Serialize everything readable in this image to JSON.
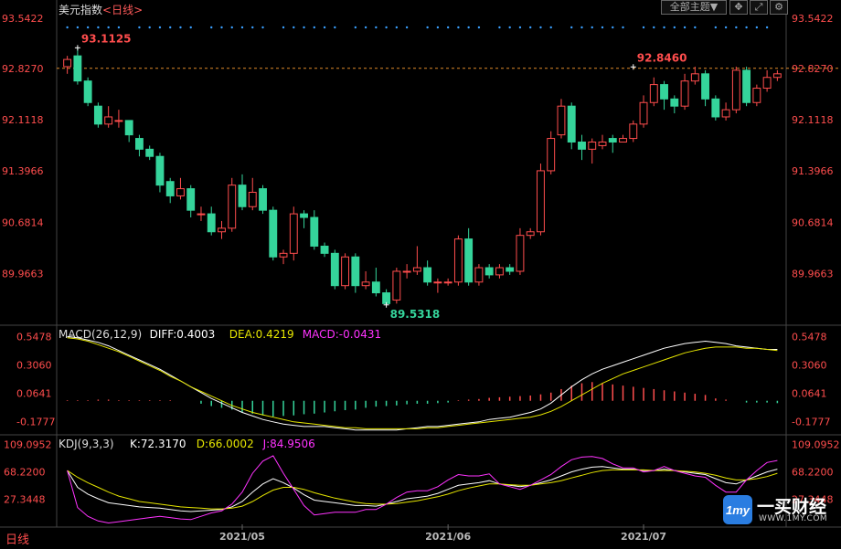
{
  "header": {
    "symbol": "美元指数",
    "period_link": "<日线>",
    "theme_button": "全部主题▼",
    "icons": [
      "move-icon",
      "expand-icon",
      "settings-icon"
    ]
  },
  "footer": {
    "period_label": "日线"
  },
  "watermark": {
    "brand": "一买财经",
    "url": "WWW.1MY.COM"
  },
  "colors": {
    "up": "#ff4d4d",
    "down": "#35d49b",
    "diff": "#ffffff",
    "dea": "#e6e600",
    "macd": "#ff33ff",
    "k": "#ffffff",
    "d": "#e6e600",
    "j": "#ff33ff",
    "axis": "#ff4d4d"
  },
  "chart_data": [
    {
      "type": "candlestick",
      "title": "",
      "y_ticks": [
        "93.5422",
        "92.8270",
        "92.1118",
        "91.3966",
        "90.6814",
        "89.9663"
      ],
      "ylim": [
        89.3,
        93.6
      ],
      "reference_line": 92.827,
      "annotations": [
        {
          "label": "93.1125",
          "index": 1,
          "value": 93.1125
        },
        {
          "label": "92.8460",
          "index": 55,
          "value": 92.846
        },
        {
          "label": "89.5318",
          "index": 31,
          "value": 89.5318
        }
      ],
      "x_ticks": [
        {
          "label": "2021/05",
          "index": 17
        },
        {
          "label": "2021/06",
          "index": 37
        },
        {
          "label": "2021/07",
          "index": 56
        }
      ],
      "candles": [
        [
          92.85,
          92.95,
          93.0,
          92.75
        ],
        [
          93.0,
          92.65,
          93.11,
          92.6
        ],
        [
          92.65,
          92.35,
          92.7,
          92.3
        ],
        [
          92.3,
          92.05,
          92.35,
          92.0
        ],
        [
          92.05,
          92.15,
          92.3,
          92.0
        ],
        [
          92.1,
          92.1,
          92.25,
          92.0
        ],
        [
          92.1,
          91.9,
          92.1,
          91.8
        ],
        [
          91.85,
          91.7,
          91.9,
          91.6
        ],
        [
          91.7,
          91.6,
          91.75,
          91.55
        ],
        [
          91.6,
          91.2,
          91.65,
          91.1
        ],
        [
          91.25,
          91.05,
          91.3,
          90.95
        ],
        [
          91.05,
          91.15,
          91.3,
          91.0
        ],
        [
          91.15,
          90.85,
          91.2,
          90.75
        ],
        [
          90.8,
          90.8,
          90.9,
          90.7
        ],
        [
          90.8,
          90.55,
          90.9,
          90.5
        ],
        [
          90.55,
          90.6,
          90.7,
          90.45
        ],
        [
          90.6,
          91.2,
          91.3,
          90.55
        ],
        [
          91.2,
          90.9,
          91.35,
          90.85
        ],
        [
          90.9,
          91.1,
          91.3,
          90.85
        ],
        [
          91.15,
          90.85,
          91.2,
          90.8
        ],
        [
          90.85,
          90.2,
          90.9,
          90.15
        ],
        [
          90.2,
          90.25,
          90.3,
          90.1
        ],
        [
          90.25,
          90.8,
          90.9,
          90.15
        ],
        [
          90.8,
          90.75,
          90.85,
          90.6
        ],
        [
          90.75,
          90.35,
          90.85,
          90.3
        ],
        [
          90.35,
          90.25,
          90.4,
          90.2
        ],
        [
          90.25,
          89.8,
          90.3,
          89.75
        ],
        [
          89.8,
          90.2,
          90.25,
          89.75
        ],
        [
          90.2,
          89.8,
          90.25,
          89.7
        ],
        [
          89.8,
          89.85,
          90.0,
          89.75
        ],
        [
          89.85,
          89.7,
          90.05,
          89.65
        ],
        [
          89.7,
          89.55,
          89.75,
          89.53
        ],
        [
          89.6,
          90.0,
          90.05,
          89.55
        ],
        [
          90.0,
          90.0,
          90.1,
          89.9
        ],
        [
          90.0,
          90.05,
          90.35,
          89.95
        ],
        [
          90.05,
          89.85,
          90.15,
          89.8
        ],
        [
          89.85,
          89.85,
          89.9,
          89.7
        ],
        [
          89.85,
          89.85,
          89.9,
          89.8
        ],
        [
          89.85,
          90.45,
          90.5,
          89.8
        ],
        [
          90.45,
          89.85,
          90.6,
          89.8
        ],
        [
          89.85,
          90.05,
          90.1,
          89.8
        ],
        [
          90.05,
          89.95,
          90.1,
          89.9
        ],
        [
          89.95,
          90.05,
          90.1,
          89.9
        ],
        [
          90.05,
          90.0,
          90.1,
          89.95
        ],
        [
          90.0,
          90.5,
          90.6,
          89.95
        ],
        [
          90.5,
          90.55,
          90.6,
          90.45
        ],
        [
          90.55,
          91.4,
          91.5,
          90.5
        ],
        [
          91.4,
          91.85,
          91.95,
          91.35
        ],
        [
          91.9,
          92.3,
          92.4,
          91.85
        ],
        [
          92.3,
          91.8,
          92.35,
          91.7
        ],
        [
          91.8,
          91.7,
          91.9,
          91.55
        ],
        [
          91.7,
          91.8,
          91.85,
          91.5
        ],
        [
          91.75,
          91.8,
          91.9,
          91.7
        ],
        [
          91.85,
          91.8,
          91.9,
          91.65
        ],
        [
          91.8,
          91.85,
          91.9,
          91.8
        ],
        [
          91.85,
          92.05,
          92.1,
          91.8
        ],
        [
          92.05,
          92.35,
          92.45,
          92.0
        ],
        [
          92.35,
          92.6,
          92.7,
          92.3
        ],
        [
          92.6,
          92.4,
          92.65,
          92.25
        ],
        [
          92.4,
          92.3,
          92.45,
          92.2
        ],
        [
          92.3,
          92.65,
          92.75,
          92.25
        ],
        [
          92.65,
          92.75,
          92.85,
          92.6
        ],
        [
          92.75,
          92.4,
          92.8,
          92.3
        ],
        [
          92.4,
          92.15,
          92.45,
          92.1
        ],
        [
          92.15,
          92.25,
          92.35,
          92.1
        ],
        [
          92.25,
          92.8,
          92.85,
          92.2
        ],
        [
          92.8,
          92.35,
          92.85,
          92.3
        ],
        [
          92.35,
          92.55,
          92.6,
          92.3
        ],
        [
          92.55,
          92.7,
          92.8,
          92.5
        ],
        [
          92.7,
          92.75,
          92.8,
          92.65
        ]
      ]
    },
    {
      "type": "macd",
      "title": "MACD(26,12,9)",
      "legend": [
        {
          "key": "diff",
          "text": "DIFF:0.4003"
        },
        {
          "key": "dea",
          "text": "DEA:0.4219"
        },
        {
          "key": "macd",
          "text": "MACD:-0.0431"
        }
      ],
      "y_ticks": [
        "0.5478",
        "0.3060",
        "0.0641",
        "-0.1777"
      ],
      "ylim": [
        -0.26,
        0.6
      ],
      "diff": [
        0.55,
        0.54,
        0.52,
        0.5,
        0.47,
        0.43,
        0.39,
        0.35,
        0.31,
        0.27,
        0.22,
        0.17,
        0.12,
        0.07,
        0.02,
        -0.02,
        -0.06,
        -0.1,
        -0.13,
        -0.16,
        -0.18,
        -0.2,
        -0.21,
        -0.22,
        -0.22,
        -0.22,
        -0.23,
        -0.24,
        -0.25,
        -0.25,
        -0.25,
        -0.25,
        -0.25,
        -0.24,
        -0.23,
        -0.22,
        -0.22,
        -0.21,
        -0.2,
        -0.19,
        -0.18,
        -0.16,
        -0.15,
        -0.14,
        -0.12,
        -0.1,
        -0.07,
        -0.02,
        0.05,
        0.12,
        0.18,
        0.23,
        0.27,
        0.3,
        0.33,
        0.36,
        0.39,
        0.42,
        0.45,
        0.47,
        0.49,
        0.5,
        0.51,
        0.5,
        0.49,
        0.47,
        0.46,
        0.45,
        0.44,
        0.44
      ],
      "dea": [
        0.54,
        0.53,
        0.51,
        0.48,
        0.45,
        0.42,
        0.38,
        0.34,
        0.3,
        0.26,
        0.21,
        0.17,
        0.12,
        0.08,
        0.04,
        0.0,
        -0.04,
        -0.07,
        -0.1,
        -0.12,
        -0.14,
        -0.16,
        -0.18,
        -0.19,
        -0.2,
        -0.21,
        -0.22,
        -0.23,
        -0.23,
        -0.24,
        -0.24,
        -0.24,
        -0.24,
        -0.24,
        -0.24,
        -0.23,
        -0.23,
        -0.22,
        -0.21,
        -0.2,
        -0.19,
        -0.18,
        -0.17,
        -0.16,
        -0.15,
        -0.14,
        -0.12,
        -0.09,
        -0.05,
        0.0,
        0.05,
        0.1,
        0.15,
        0.19,
        0.23,
        0.26,
        0.29,
        0.32,
        0.35,
        0.38,
        0.41,
        0.43,
        0.45,
        0.46,
        0.46,
        0.46,
        0.45,
        0.45,
        0.44,
        0.43
      ],
      "hist": [
        0.01,
        0.01,
        0.01,
        0.02,
        0.02,
        0.01,
        0.01,
        0.01,
        0.01,
        0.01,
        0.01,
        0.0,
        0.0,
        -0.05,
        -0.09,
        -0.12,
        -0.15,
        -0.2,
        -0.22,
        -0.25,
        -0.27,
        -0.26,
        -0.25,
        -0.23,
        -0.22,
        -0.2,
        -0.18,
        -0.16,
        -0.15,
        -0.12,
        -0.1,
        -0.09,
        -0.08,
        -0.06,
        -0.05,
        -0.05,
        -0.04,
        -0.03,
        0.01,
        0.02,
        0.03,
        0.05,
        0.06,
        0.07,
        0.08,
        0.09,
        0.11,
        0.14,
        0.2,
        0.26,
        0.3,
        0.32,
        0.3,
        0.28,
        0.26,
        0.24,
        0.22,
        0.2,
        0.18,
        0.16,
        0.14,
        0.12,
        0.1,
        0.04,
        0.02,
        0.0,
        -0.03,
        -0.03,
        -0.03,
        -0.04
      ]
    },
    {
      "type": "kdj",
      "title": "KDJ(9,3,3)",
      "legend": [
        {
          "key": "k",
          "text": "K:72.3170"
        },
        {
          "key": "d",
          "text": "D:66.0002"
        },
        {
          "key": "j",
          "text": "J:84.9506"
        }
      ],
      "y_ticks": [
        "109.0952",
        "68.2200",
        "27.3448"
      ],
      "ylim": [
        -10,
        115
      ],
      "k": [
        70,
        45,
        35,
        28,
        22,
        20,
        18,
        16,
        15,
        14,
        12,
        10,
        9,
        10,
        11,
        12,
        16,
        24,
        38,
        50,
        58,
        52,
        44,
        34,
        26,
        24,
        22,
        20,
        18,
        18,
        17,
        20,
        24,
        28,
        30,
        32,
        36,
        42,
        48,
        50,
        52,
        55,
        50,
        48,
        46,
        48,
        52,
        56,
        62,
        68,
        72,
        75,
        76,
        74,
        72,
        72,
        70,
        70,
        72,
        70,
        68,
        66,
        64,
        58,
        52,
        50,
        56,
        62,
        68,
        72
      ],
      "d": [
        70,
        60,
        52,
        45,
        38,
        32,
        28,
        24,
        22,
        20,
        18,
        16,
        15,
        14,
        13,
        13,
        14,
        17,
        24,
        33,
        41,
        45,
        45,
        42,
        37,
        33,
        29,
        26,
        23,
        21,
        20,
        20,
        21,
        23,
        25,
        28,
        31,
        35,
        40,
        44,
        47,
        50,
        50,
        49,
        48,
        48,
        50,
        52,
        55,
        59,
        63,
        67,
        70,
        71,
        71,
        71,
        71,
        70,
        70,
        70,
        69,
        68,
        66,
        63,
        59,
        56,
        56,
        58,
        61,
        66
      ],
      "j": [
        70,
        15,
        2,
        -5,
        -8,
        -6,
        -4,
        -2,
        0,
        2,
        0,
        -2,
        -3,
        2,
        7,
        10,
        20,
        38,
        66,
        84,
        92,
        66,
        42,
        18,
        4,
        6,
        8,
        8,
        8,
        12,
        12,
        20,
        30,
        38,
        40,
        40,
        46,
        56,
        64,
        62,
        62,
        65,
        50,
        46,
        42,
        48,
        56,
        64,
        76,
        86,
        90,
        91,
        88,
        80,
        74,
        74,
        68,
        70,
        76,
        70,
        66,
        62,
        60,
        48,
        38,
        38,
        56,
        70,
        82,
        85
      ]
    }
  ]
}
